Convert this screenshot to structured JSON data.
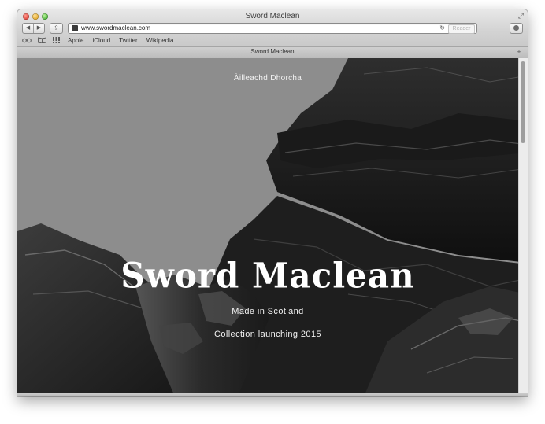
{
  "window": {
    "title": "Sword Maclean",
    "fullscreen_icon": "fullscreen-icon"
  },
  "toolbar": {
    "back_icon": "◀",
    "forward_icon": "▶",
    "share_icon": "⇪",
    "address": "www.swordmaclean.com",
    "reload_icon": "↻",
    "reader_label": "Reader"
  },
  "bookmarks": {
    "reading_list_icon": "reading-list-icon",
    "bookmarks_icon": "bookmarks-icon",
    "top_sites_icon": "top-sites-icon",
    "items": [
      "Apple",
      "iCloud",
      "Twitter",
      "Wikipedia"
    ]
  },
  "tab": {
    "title": "Sword Maclean",
    "new_tab_label": "+"
  },
  "page": {
    "gaelic_heading": "Àilleachd Dhorcha",
    "brand": "Sword Maclean",
    "made_in": "Made in Scotland",
    "launch": "Collection launching 2015"
  },
  "colors": {
    "sky": "#8c8c8c",
    "rock_dark": "#1c1c1c",
    "rock_mid": "#3a3a3a",
    "text": "#f2f2f2"
  }
}
